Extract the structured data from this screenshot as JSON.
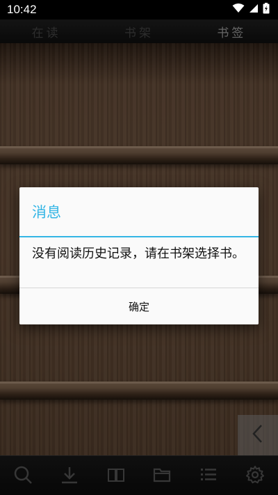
{
  "status_bar": {
    "time": "10:42",
    "wifi_icon": "wifi-icon",
    "signal_icon": "signal-icon",
    "battery_icon": "battery-icon"
  },
  "top_tabs": [
    {
      "label": "在读",
      "active": false
    },
    {
      "label": "书架",
      "active": false
    },
    {
      "label": "书签",
      "active": true
    }
  ],
  "dialog": {
    "title": "消息",
    "message": "没有阅读历史记录，请在书架选择书。",
    "confirm_label": "确定"
  },
  "side_button": {
    "icon": "chevron-left-icon"
  },
  "bottom_toolbar": [
    {
      "icon": "search-icon"
    },
    {
      "icon": "download-icon"
    },
    {
      "icon": "book-icon"
    },
    {
      "icon": "folder-icon"
    },
    {
      "icon": "list-icon"
    },
    {
      "icon": "gear-icon"
    }
  ],
  "colors": {
    "accent": "#33b5e5",
    "wood": "#5e4634",
    "toolbar_icon": "#4a4a4a"
  }
}
